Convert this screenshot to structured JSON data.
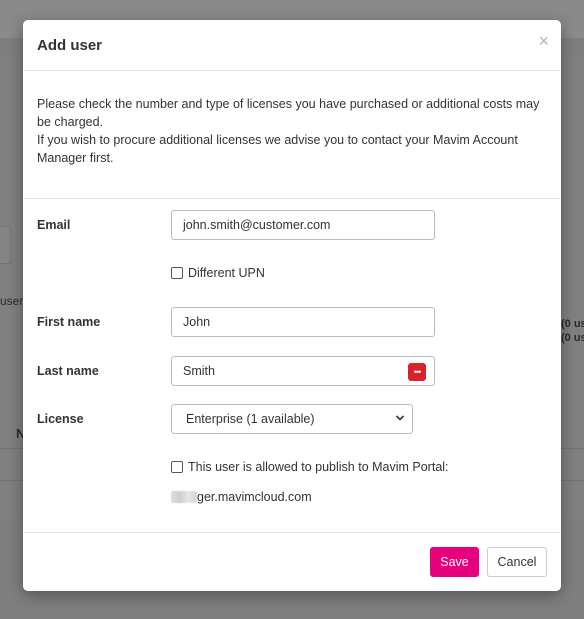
{
  "background": {
    "fragments": [
      "user",
      "N"
    ],
    "right_fragments": [
      "(0 us",
      "(0 us"
    ]
  },
  "dialog": {
    "title": "Add user",
    "close_symbol": "×",
    "notice": {
      "line1": "Please check the number and type of licenses you have purchased or additional costs may be charged.",
      "line2": "If you wish to procure additional licenses we advise you to contact your Mavim Account Manager first."
    },
    "fields": {
      "email": {
        "label": "Email",
        "value": "john.smith@customer.com"
      },
      "different_upn": {
        "label": "Different UPN",
        "checked": false
      },
      "first_name": {
        "label": "First name",
        "value": "John"
      },
      "last_name": {
        "label": "Last name",
        "value": "Smith",
        "password_manager_icon": "password-manager-icon"
      },
      "license": {
        "label": "License",
        "selected": "Enterprise (1 available)"
      },
      "publish_portal": {
        "label": "This user is allowed to publish to Mavim Portal:",
        "checked": false
      },
      "portal_url": "ger.mavimcloud.com"
    },
    "buttons": {
      "save": "Save",
      "cancel": "Cancel"
    },
    "colors": {
      "save_button": "#e6007e",
      "password_icon": "#d8232a"
    }
  }
}
